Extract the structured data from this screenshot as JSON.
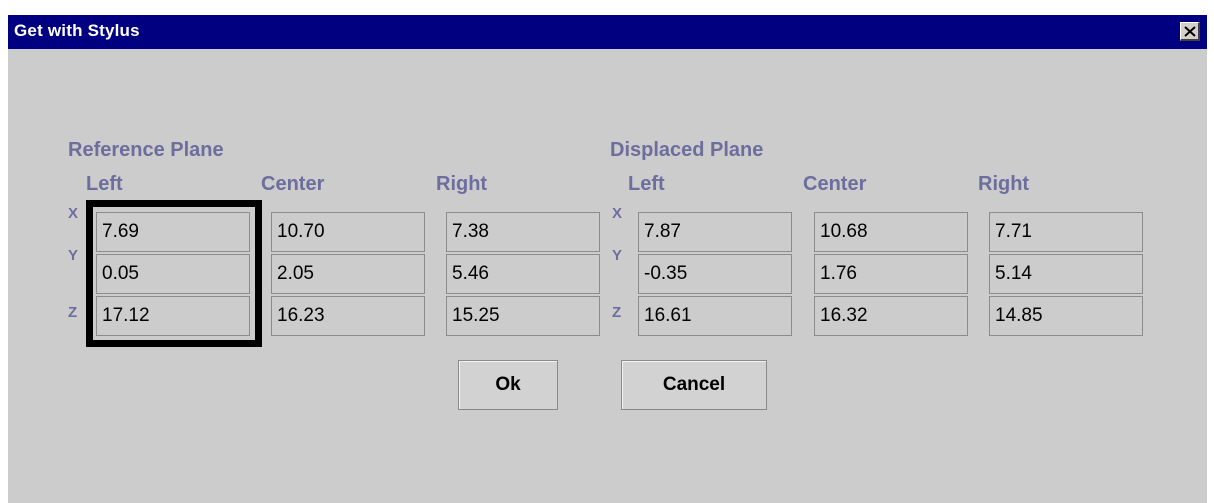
{
  "window": {
    "title": "Get with Stylus",
    "close_icon": "close-icon"
  },
  "reference": {
    "title": "Reference Plane",
    "columns": [
      "Left",
      "Center",
      "Right"
    ],
    "axes": [
      "X",
      "Y",
      "Z"
    ],
    "values": [
      [
        "7.69",
        "10.70",
        "7.38"
      ],
      [
        "0.05",
        "2.05",
        "5.46"
      ],
      [
        "17.12",
        "16.23",
        "15.25"
      ]
    ]
  },
  "displaced": {
    "title": "Displaced Plane",
    "columns": [
      "Left",
      "Center",
      "Right"
    ],
    "axes": [
      "X",
      "Y",
      "Z"
    ],
    "values": [
      [
        "7.87",
        "10.68",
        "7.71"
      ],
      [
        "-0.35",
        "1.76",
        "5.14"
      ],
      [
        "16.61",
        "16.32",
        "14.85"
      ]
    ]
  },
  "buttons": {
    "ok": "Ok",
    "cancel": "Cancel"
  },
  "colors": {
    "titlebar": "#000080",
    "background": "#cccccc",
    "label": "#6d6d9e"
  }
}
